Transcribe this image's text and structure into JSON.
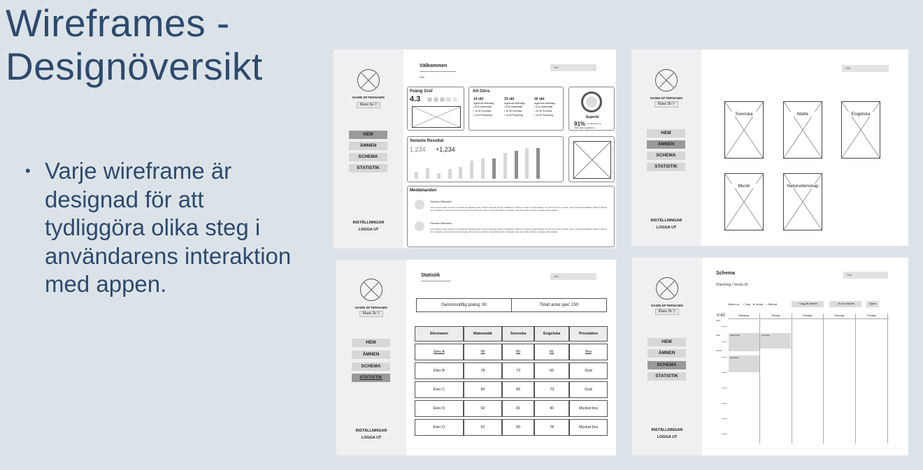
{
  "slide": {
    "title": "Wireframes - Designöversikt",
    "bullet": "Varje wireframe är designad för att tydliggöra olika steg i användarens interaktion med appen."
  },
  "common": {
    "user_name": "NAMN EFTERNAMN",
    "nav": [
      "HEM",
      "ÄMNEN",
      "SCHEMA",
      "STATISTIK"
    ],
    "settings": "INSTÄLLNINGAR",
    "logout": "LOGGA UT",
    "search_placeholder": "Sök"
  },
  "home": {
    "class_select": "Klass 5a",
    "title": "Välkommen",
    "greeting": "Hi!!!",
    "points_title": "Poäng Graf",
    "points_value": "4.3",
    "todo_title": "Att Göra",
    "todo_cols": [
      {
        "time": "14 okt",
        "head": "Agenda måndag:",
        "items": [
          "8:00 Matematik",
          "10:30 Svenska",
          "14:00 Planering"
        ]
      },
      {
        "time": "15 okt",
        "head": "Agenda måndag:",
        "items": [
          "8:00 Matematik",
          "10:30 Svenska",
          "14:00 Planering"
        ]
      },
      {
        "time": "16 okt",
        "head": "Agenda måndag:",
        "items": [
          "8:00 Matematik",
          "10:30 Svenska",
          "14:00 Planering"
        ]
      }
    ],
    "progress_label": "Superbl",
    "progress_percent": "91%",
    "progress_note": "av dina prov &",
    "progress_note2": "inlämnade uppgifterna",
    "results_title": "Senaste Resultat",
    "results_num1": "1,234",
    "results_num2": "+1,234",
    "bars": [
      {
        "h": 0.22,
        "dark": false
      },
      {
        "h": 0.35,
        "dark": false
      },
      {
        "h": 0.18,
        "dark": false
      },
      {
        "h": 0.32,
        "dark": false
      },
      {
        "h": 0.38,
        "dark": false
      },
      {
        "h": 0.6,
        "dark": false
      },
      {
        "h": 0.65,
        "dark": false
      },
      {
        "h": 0.65,
        "dark": true
      },
      {
        "h": 0.85,
        "dark": false
      },
      {
        "h": 0.9,
        "dark": true
      },
      {
        "h": 1.0,
        "dark": false
      },
      {
        "h": 1.0,
        "dark": true
      }
    ],
    "messages_title": "Meddelanden",
    "messages": [
      {
        "sender": "Förnamn Efternamn",
        "text": "Lorem ipsum dolor sit amet, consectetur adipiscing elit, sed do eiusmod tempor incididunt ut labore et dolore magna aliqua. Ut enim ad minim veniam, quis nostrud exercitation ullamco laboris nisi ut aliquip ex ea commodo consequat. Duis aute irure dolor in reprehenderit in voluptate velit esse cillum dolore eu fugiat nulla pariatur."
      },
      {
        "sender": "Förnamn Efternamn",
        "text": "Lorem ipsum dolor sit amet, consectetur adipiscing elit, sed do eiusmod tempor incididunt ut labore et dolore magna aliqua. Ut enim ad minim veniam, quis nostrud exercitation ullamco laboris nisi ut aliquip ex ea commodo consequat. Duis aute irure dolor in reprehenderit in voluptate velit esse cillum dolore eu fugiat nulla pariatur."
      }
    ]
  },
  "subjects": {
    "class_select": "Klass 2b",
    "items": [
      "Svenska",
      "Matte",
      "Engelska",
      "Musik",
      "Naturvetenskap"
    ]
  },
  "stats": {
    "class_select": "Klass 2b",
    "title": "Statistik",
    "avg": "Genomsnittlig poäng: 80",
    "total": "Totalt antal spel: 150",
    "headers": [
      "Elevnamn",
      "Matematik",
      "Svenska",
      "Engelska",
      "Prestation"
    ],
    "rows": [
      [
        "Elev A",
        "95",
        "60",
        "81",
        "Bra"
      ],
      [
        "Elev B",
        "78",
        "73",
        "56",
        "God"
      ],
      [
        "Elev C",
        "90",
        "85",
        "73",
        "God"
      ],
      [
        "Elev D",
        "92",
        "81",
        "90",
        "Mycket bra"
      ],
      [
        "Elev D",
        "92",
        "90",
        "78",
        "Mycket bra"
      ]
    ]
  },
  "schedule": {
    "class_select": "Klass 2b",
    "title": "Schema",
    "subtitle": "Planering / Vecka 42",
    "view_label": "Ändra vy:",
    "view_options": [
      "Dag",
      "Vecka",
      "Månad"
    ],
    "btn_add": "+ Lägg till aktivitet",
    "btn_remove": "- Ta bort aktivitet",
    "btn_save": "Spara",
    "week": "V.42",
    "days": [
      "Måndag",
      "Tisdag",
      "Onsdag",
      "Torsdag",
      "Fredag"
    ],
    "times": [
      "8:00",
      "9:00",
      "10:00"
    ],
    "events": [
      "Matematik",
      "Svenska",
      "Engelska"
    ]
  }
}
